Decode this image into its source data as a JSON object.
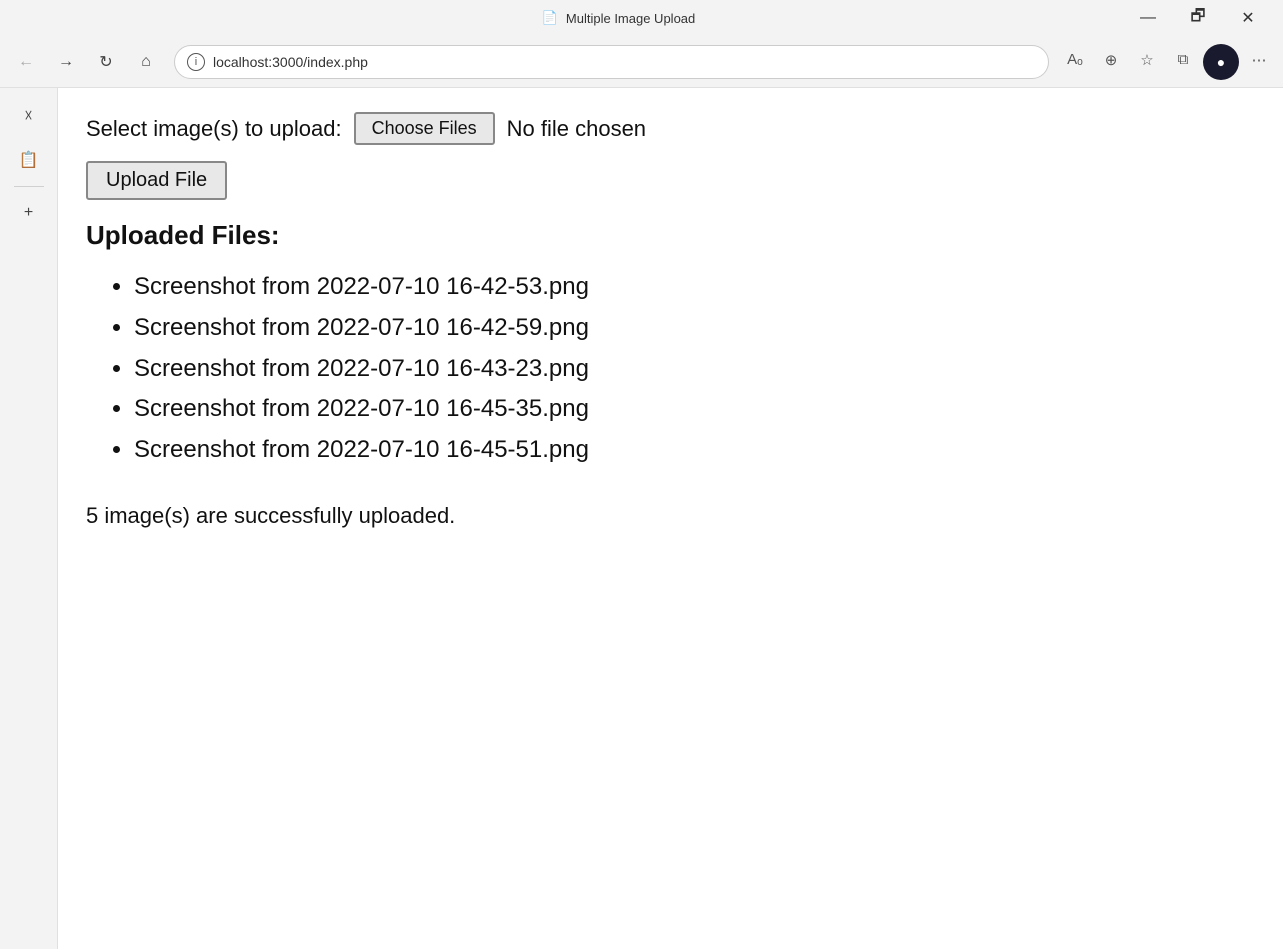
{
  "window": {
    "title": "Multiple Image Upload",
    "title_icon": "📄"
  },
  "titlebar": {
    "minimize_label": "—",
    "maximize_label": "🗗",
    "close_label": "✕"
  },
  "addressbar": {
    "back_icon": "←",
    "forward_icon": "→",
    "refresh_icon": "↻",
    "home_icon": "⌂",
    "url": "localhost:3000/index.php",
    "read_mode_icon": "A",
    "zoom_icon": "⊕",
    "favorites_icon": "☆",
    "collections_icon": "⧉",
    "more_icon": "⋯"
  },
  "sidebar": {
    "favorites_icon": "☆",
    "reading_list_icon": "📋",
    "add_icon": "+"
  },
  "page": {
    "select_label": "Select image(s) to upload:",
    "choose_files_btn": "Choose Files",
    "no_file_text": "No file chosen",
    "upload_btn": "Upload File",
    "uploaded_heading": "Uploaded Files:",
    "files": [
      "Screenshot from 2022-07-10 16-42-53.png",
      "Screenshot from 2022-07-10 16-42-59.png",
      "Screenshot from 2022-07-10 16-43-23.png",
      "Screenshot from 2022-07-10 16-45-35.png",
      "Screenshot from 2022-07-10 16-45-51.png"
    ],
    "success_text": "5 image(s) are successfully uploaded."
  }
}
